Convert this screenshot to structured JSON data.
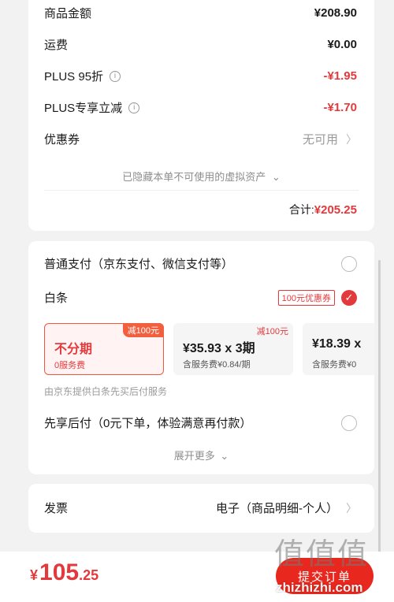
{
  "price_breakdown": {
    "goods_amount": {
      "label": "商品金额",
      "value": "¥208.90"
    },
    "shipping": {
      "label": "运费",
      "value": "¥0.00"
    },
    "plus_discount": {
      "label": "PLUS 95折",
      "value": "-¥1.95"
    },
    "plus_reduction": {
      "label": "PLUS专享立减",
      "value": "-¥1.70"
    },
    "coupon": {
      "label": "优惠券",
      "value": "无可用"
    },
    "hidden_note": "已隐藏本单不可使用的虚拟资产",
    "total_label": "合计:",
    "total_value": "¥205.25"
  },
  "payment": {
    "normal_label": "普通支付（京东支付、微信支付等）",
    "baitiao_label": "白条",
    "baitiao_coupon": "100元优惠券",
    "plans": [
      {
        "badge": "减100元",
        "main": "不分期",
        "sub": "0服务费"
      },
      {
        "badge": "减100元",
        "main": "¥35.93 x 3期",
        "sub": "含服务费¥0.84/期"
      },
      {
        "badge": "",
        "main": "¥18.39 x",
        "sub": "含服务费¥0"
      }
    ],
    "provider_note": "由京东提供白条先买后付服务",
    "later_label": "先享后付（0元下单，体验满意再付款）",
    "expand_label": "展开更多"
  },
  "invoice": {
    "label": "发票",
    "value": "电子（商品明细-个人）"
  },
  "bottom": {
    "currency": "¥",
    "amount_int": "105",
    "amount_dec": ".25",
    "submit_label": "提交订单"
  },
  "watermark": {
    "glyphs": "值值值",
    "text": "zhizhizhi.com"
  },
  "colors": {
    "accent": "#e4393c",
    "button": "#e8281e"
  },
  "icons": [
    "info-icon",
    "chevron-right-icon",
    "chevron-down-icon",
    "radio-unchecked-icon",
    "radio-checked-icon"
  ]
}
